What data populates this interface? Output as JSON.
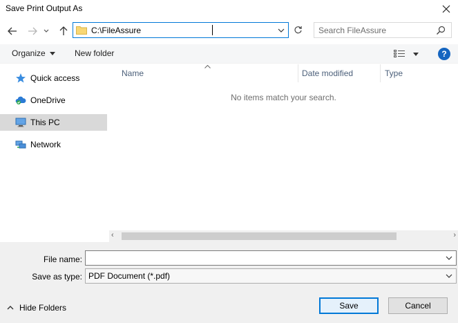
{
  "window": {
    "title": "Save Print Output As"
  },
  "nav": {
    "address": "C:\\FileAssure",
    "search_placeholder": "Search FileAssure"
  },
  "toolbar": {
    "organize": "Organize",
    "new_folder": "New folder",
    "help": "?"
  },
  "sidebar": {
    "items": [
      {
        "label": "Quick access",
        "icon": "star-icon"
      },
      {
        "label": "OneDrive",
        "icon": "cloud-icon"
      },
      {
        "label": "This PC",
        "icon": "computer-icon",
        "selected": true
      },
      {
        "label": "Network",
        "icon": "network-icon"
      }
    ]
  },
  "content": {
    "columns": [
      "Name",
      "Date modified",
      "Type"
    ],
    "empty_message": "No items match your search."
  },
  "bottom": {
    "file_name_label": "File name:",
    "file_name_value": "",
    "save_type_label": "Save as type:",
    "save_type_value": "PDF Document (*.pdf)",
    "hide_folders": "Hide Folders",
    "save": "Save",
    "cancel": "Cancel"
  },
  "colors": {
    "accent": "#0078d7",
    "selected_bg": "#d9d9d9",
    "help_blue": "#1565c0"
  }
}
